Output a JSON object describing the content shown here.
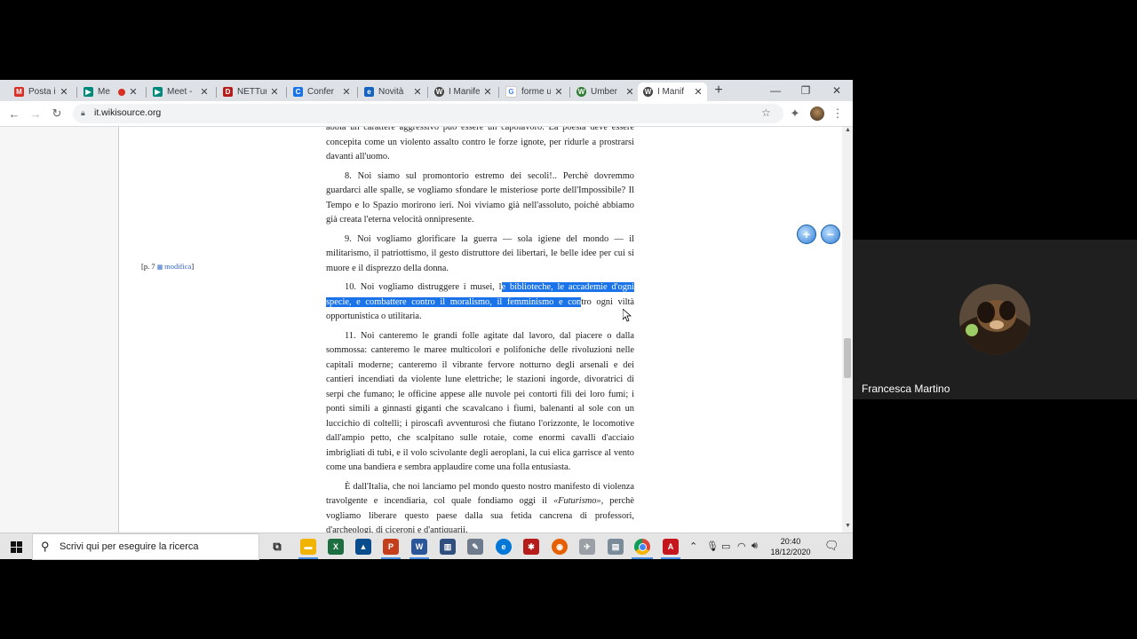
{
  "browser": {
    "tabs": [
      {
        "label": "Posta in",
        "favicon": "gmail-icon",
        "color": "#d93025"
      },
      {
        "label": "Me",
        "favicon": "meet-icon",
        "color": "#00897b",
        "recording": true
      },
      {
        "label": "Meet -",
        "favicon": "meet-icon",
        "color": "#00897b"
      },
      {
        "label": "NETTur",
        "favicon": "nettuno-icon",
        "color": "#b71c1c"
      },
      {
        "label": "Confer",
        "favicon": "conference-icon",
        "color": "#1a73e8"
      },
      {
        "label": "Novità",
        "favicon": "edge-news-icon",
        "color": "#1565c0"
      },
      {
        "label": "I Manife",
        "favicon": "wikisource-icon",
        "color": "#444"
      },
      {
        "label": "forme u",
        "favicon": "google-icon",
        "color": "#4285f4"
      },
      {
        "label": "Umber",
        "favicon": "wikipedia-icon",
        "color": "#2e7d32"
      },
      {
        "label": "I Manif",
        "favicon": "wikisource-icon",
        "color": "#444",
        "active": true
      }
    ],
    "new_tab": "+",
    "url": "it.wikisource.org"
  },
  "page": {
    "page_ref_prefix": "[p. 7",
    "page_ref_link": "modifica",
    "page_ref_suffix": "]",
    "paragraphs": {
      "p0": "abbia un carattere aggressivo può essere un capolavoro. La poesia deve essere concepita come un violento assalto contro le forze ignote, per ridurle a prostrarsi davanti all'uomo.",
      "p8": "8. Noi siamo sul promontorio estremo dei secoli!.. Perchè dovremmo guardarci alle spalle, se vogliamo sfondare le misteriose porte dell'Impossibile? Il Tempo e lo Spazio morirono ieri. Noi viviamo già nell'assoluto, poichè abbiamo già creata l'eterna velocità onnipresente.",
      "p9": "9. Noi vogliamo glorificare la guerra — sola igiene del mondo — il militarismo, il patriottismo, il gesto distruttore dei libertari, le belle idee per cui si muore e il disprezzo della donna.",
      "p10_before": "10. Noi vogliamo distruggere i musei, l",
      "p10_selected": "e biblioteche, le accademie d'ogni specie, e combattere contro il moralismo, il femminismo e con",
      "p10_after": "tro ogni viltà opportunistica o utilitaria.",
      "p11": "11. Noi canteremo le grandi folle agitate dal lavoro, dal piacere o dalla sommossa: canteremo le maree multicolori e polifoniche delle rivoluzioni nelle capitali moderne; canteremo il vibrante fervore notturno degli arsenali e dei cantieri incendiati da violente lune elettriche; le stazioni ingorde, divoratrici di serpi che fumano; le officine appese alle nuvole pei contorti fili dei loro fumi; i ponti simili a ginnasti giganti che scavalcano i fiumi, balenanti al sole con un luccichio di coltelli; i piroscafi avventurosi che fiutano l'orizzonte, le locomotive dall'ampio petto, che scalpitano sulle rotaie, come enormi cavalli d'acciaio imbrigliati di tubi, e il volo scivolante degli aeroplani, la cui elica garrisce al vento come una bandiera e sembra applaudire come una folla entusiasta.",
      "p12_before": "È dall'Italia, che noi lanciamo pel mondo questo nostro manifesto di violenza travolgente e incendiaria, col quale fondiamo oggi il ",
      "p12_italic": "«Futurismo»",
      "p12_after": ", perchè vogliamo liberare questo paese dalla sua fetida cancrena di professori, d'archeologi, di ciceroni e d'antiquarii."
    }
  },
  "taskbar": {
    "search_placeholder": "Scrivi qui per eseguire la ricerca",
    "time": "20:40",
    "date": "18/12/2020"
  },
  "meeting": {
    "participant_name": "Francesca Martino"
  },
  "colors": {
    "selection": "#1a73e8",
    "link": "#3366cc"
  }
}
